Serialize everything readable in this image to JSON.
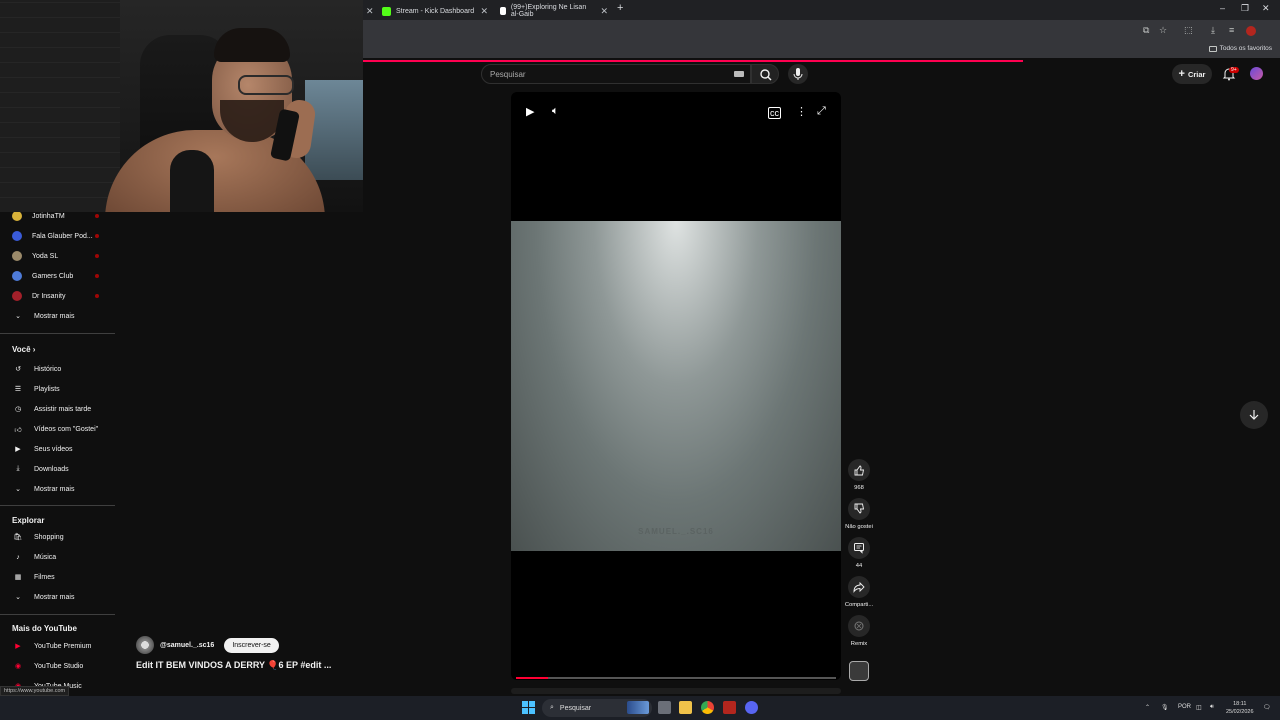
{
  "browser": {
    "tabs": [
      {
        "label": "Stream - Kick Dashboard",
        "favicon_color": "#53fc18"
      },
      {
        "label": "(99+)Exploring Ne Lisan al-Gaib",
        "favicon_color": "#ffffff"
      }
    ],
    "bookmarks_label": "Todos os favoritos"
  },
  "header": {
    "search_placeholder": "Pesquisar",
    "create_label": "Criar",
    "notif_badge": "9+"
  },
  "sidebar": {
    "subscriptions": [
      {
        "label": "JotinhaTM",
        "color": "#d8b23a"
      },
      {
        "label": "Fala Glauber Pod...",
        "color": "#3a5bd8"
      },
      {
        "label": "Yoda SL",
        "color": "#9b8a6a"
      },
      {
        "label": "Gamers Club",
        "color": "#4e7bd8"
      },
      {
        "label": "Dr Insanity",
        "color": "#a3202a"
      }
    ],
    "show_more": "Mostrar mais",
    "you_title": "Você",
    "you_items": [
      {
        "label": "Histórico",
        "icon": "history-icon"
      },
      {
        "label": "Playlists",
        "icon": "playlists-icon"
      },
      {
        "label": "Assistir mais tarde",
        "icon": "watch-later-icon"
      },
      {
        "label": "Vídeos com \"Gostei\"",
        "icon": "liked-icon"
      },
      {
        "label": "Seus vídeos",
        "icon": "your-videos-icon"
      },
      {
        "label": "Downloads",
        "icon": "downloads-icon"
      }
    ],
    "explore_title": "Explorar",
    "explore_items": [
      {
        "label": "Shopping",
        "icon": "shopping-icon"
      },
      {
        "label": "Música",
        "icon": "music-icon"
      },
      {
        "label": "Filmes",
        "icon": "movies-icon"
      }
    ],
    "more_title": "Mais do YouTube",
    "more_items": [
      {
        "label": "YouTube Premium"
      },
      {
        "label": "YouTube Studio"
      },
      {
        "label": "YouTube Music"
      }
    ],
    "status_url": "https://www.youtube.com"
  },
  "short": {
    "watermark": "SAMUEL._.SC16",
    "channel": "@samuel._.sc16",
    "subscribe_label": "Inscrever-se",
    "title": "Edit IT BEM VINDOS A DERRY 🎈6 EP #edit ...",
    "progress": 0.1
  },
  "actions": {
    "likes": "968",
    "dislike_label": "Não gostei",
    "comments": "44",
    "share_label": "Comparti...",
    "remix_label": "Remix"
  },
  "taskbar": {
    "search_label": "Pesquisar",
    "lang": "POR",
    "time": "18:11",
    "date": "25/02/2026"
  }
}
